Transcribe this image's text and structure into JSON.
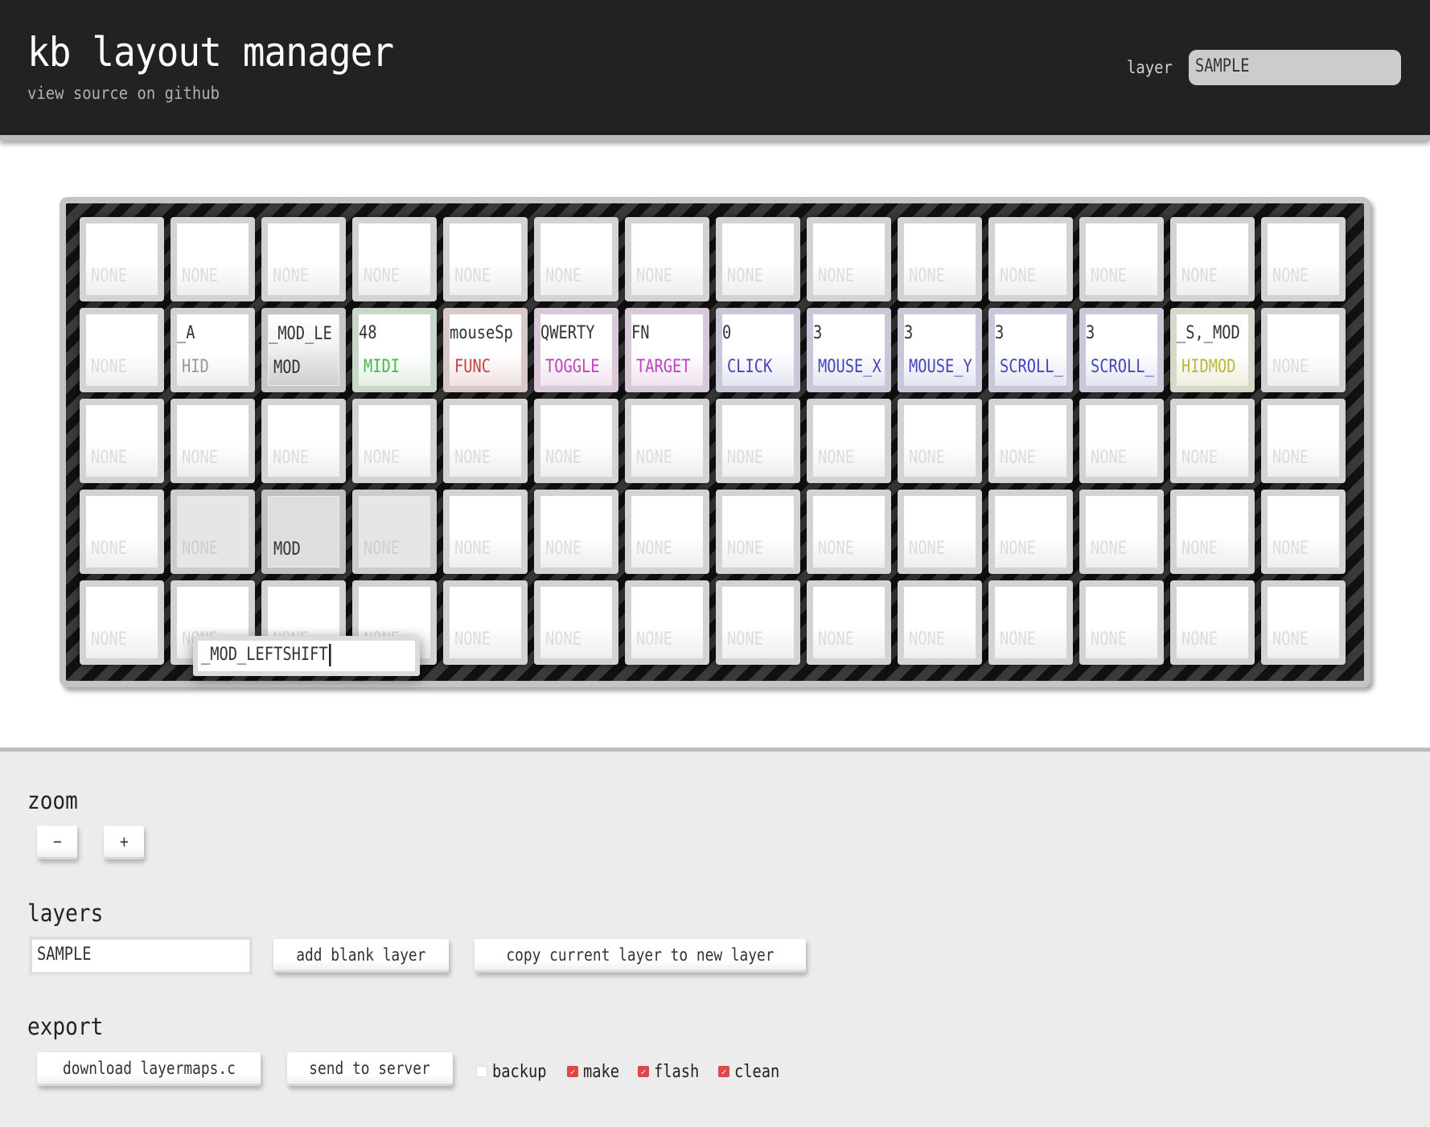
{
  "header": {
    "title": "kb layout manager",
    "subtitle_link": "view source on github",
    "layer_label": "layer",
    "layer_selected": "SAMPLE"
  },
  "keyboard": {
    "rows": [
      [
        {
          "value": "",
          "type": "NONE"
        },
        {
          "value": "",
          "type": "NONE"
        },
        {
          "value": "",
          "type": "NONE"
        },
        {
          "value": "",
          "type": "NONE"
        },
        {
          "value": "",
          "type": "NONE"
        },
        {
          "value": "",
          "type": "NONE"
        },
        {
          "value": "",
          "type": "NONE"
        },
        {
          "value": "",
          "type": "NONE"
        },
        {
          "value": "",
          "type": "NONE"
        },
        {
          "value": "",
          "type": "NONE"
        },
        {
          "value": "",
          "type": "NONE"
        },
        {
          "value": "",
          "type": "NONE"
        },
        {
          "value": "",
          "type": "NONE"
        },
        {
          "value": "",
          "type": "NONE"
        }
      ],
      [
        {
          "value": "",
          "type": "NONE"
        },
        {
          "value": "_A",
          "type": "HID"
        },
        {
          "value": "_MOD_LE",
          "type": "MOD"
        },
        {
          "value": "48",
          "type": "MIDI"
        },
        {
          "value": "mouseSp",
          "type": "FUNC"
        },
        {
          "value": "QWERTY",
          "type": "TOGGLE"
        },
        {
          "value": "FN",
          "type": "TARGET"
        },
        {
          "value": "0",
          "type": "CLICK"
        },
        {
          "value": "3",
          "type": "MOUSE_X"
        },
        {
          "value": "3",
          "type": "MOUSE_Y"
        },
        {
          "value": "3",
          "type": "SCROLL_"
        },
        {
          "value": "3",
          "type": "SCROLL_"
        },
        {
          "value": "_S,_MOD",
          "type": "HIDMOD"
        },
        {
          "value": "",
          "type": "NONE"
        }
      ],
      [
        {
          "value": "",
          "type": "NONE"
        },
        {
          "value": "",
          "type": "NONE"
        },
        {
          "value": "",
          "type": "NONE"
        },
        {
          "value": "",
          "type": "NONE"
        },
        {
          "value": "",
          "type": "NONE"
        },
        {
          "value": "",
          "type": "NONE"
        },
        {
          "value": "",
          "type": "NONE"
        },
        {
          "value": "",
          "type": "NONE"
        },
        {
          "value": "",
          "type": "NONE"
        },
        {
          "value": "",
          "type": "NONE"
        },
        {
          "value": "",
          "type": "NONE"
        },
        {
          "value": "",
          "type": "NONE"
        },
        {
          "value": "",
          "type": "NONE"
        },
        {
          "value": "",
          "type": "NONE"
        }
      ],
      [
        {
          "value": "",
          "type": "NONE"
        },
        {
          "value": "",
          "type": "NONE"
        },
        {
          "value": "",
          "type": "MOD"
        },
        {
          "value": "",
          "type": "NONE"
        },
        {
          "value": "",
          "type": "NONE"
        },
        {
          "value": "",
          "type": "NONE"
        },
        {
          "value": "",
          "type": "NONE"
        },
        {
          "value": "",
          "type": "NONE"
        },
        {
          "value": "",
          "type": "NONE"
        },
        {
          "value": "",
          "type": "NONE"
        },
        {
          "value": "",
          "type": "NONE"
        },
        {
          "value": "",
          "type": "NONE"
        },
        {
          "value": "",
          "type": "NONE"
        },
        {
          "value": "",
          "type": "NONE"
        }
      ],
      [
        {
          "value": "",
          "type": "NONE"
        },
        {
          "value": "",
          "type": "NONE"
        },
        {
          "value": "",
          "type": "NONE"
        },
        {
          "value": "",
          "type": "NONE"
        },
        {
          "value": "",
          "type": "NONE"
        },
        {
          "value": "",
          "type": "NONE"
        },
        {
          "value": "",
          "type": "NONE"
        },
        {
          "value": "",
          "type": "NONE"
        },
        {
          "value": "",
          "type": "NONE"
        },
        {
          "value": "",
          "type": "NONE"
        },
        {
          "value": "",
          "type": "NONE"
        },
        {
          "value": "",
          "type": "NONE"
        },
        {
          "value": "",
          "type": "NONE"
        },
        {
          "value": "",
          "type": "NONE"
        }
      ]
    ],
    "editor_value": "_MOD_LEFTSHIFT",
    "type_colors": {
      "MIDI": "#44bb44",
      "FUNC": "#c44444",
      "TOGGLE": "#c044c0",
      "TARGET": "#c044c0",
      "CLICK": "#4444bb",
      "MOUSE": "#4444bb",
      "HIDMOD": "#b8b840"
    }
  },
  "zoom": {
    "title": "zoom",
    "minus_label": "−",
    "plus_label": "+"
  },
  "layers": {
    "title": "layers",
    "name_value": "SAMPLE",
    "add_blank_label": "add blank layer",
    "copy_label": "copy current layer to new layer"
  },
  "export": {
    "title": "export",
    "download_label": "download layermaps.c",
    "send_label": "send to server",
    "options": [
      {
        "label": "backup",
        "checked": false
      },
      {
        "label": "make",
        "checked": true
      },
      {
        "label": "flash",
        "checked": true
      },
      {
        "label": "clean",
        "checked": true
      }
    ]
  }
}
